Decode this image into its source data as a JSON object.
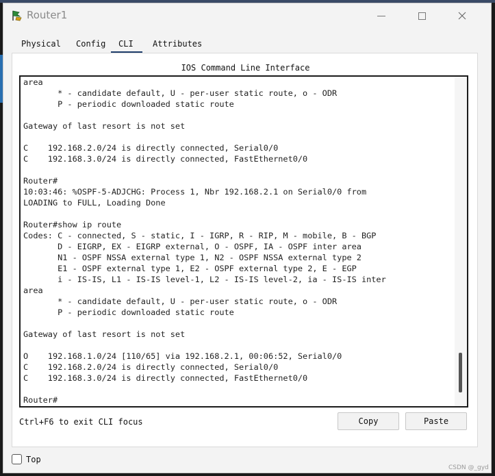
{
  "window": {
    "title": "Router1",
    "controls": {
      "minimize": "minimize",
      "maximize": "maximize",
      "close": "close"
    }
  },
  "tabs": [
    {
      "label": "Physical"
    },
    {
      "label": "Config"
    },
    {
      "label": "CLI",
      "active": true
    },
    {
      "label": "Attributes"
    }
  ],
  "cli": {
    "title": "IOS Command Line Interface",
    "lines": [
      "area",
      "       * - candidate default, U - per-user static route, o - ODR",
      "       P - periodic downloaded static route",
      "",
      "Gateway of last resort is not set",
      "",
      "C    192.168.2.0/24 is directly connected, Serial0/0",
      "C    192.168.3.0/24 is directly connected, FastEthernet0/0",
      "",
      "Router#",
      "10:03:46: %OSPF-5-ADJCHG: Process 1, Nbr 192.168.2.1 on Serial0/0 from",
      "LOADING to FULL, Loading Done",
      "",
      "Router#show ip route",
      "Codes: C - connected, S - static, I - IGRP, R - RIP, M - mobile, B - BGP",
      "       D - EIGRP, EX - EIGRP external, O - OSPF, IA - OSPF inter area",
      "       N1 - OSPF NSSA external type 1, N2 - OSPF NSSA external type 2",
      "       E1 - OSPF external type 1, E2 - OSPF external type 2, E - EGP",
      "       i - IS-IS, L1 - IS-IS level-1, L2 - IS-IS level-2, ia - IS-IS inter",
      "area",
      "       * - candidate default, U - per-user static route, o - ODR",
      "       P - periodic downloaded static route",
      "",
      "Gateway of last resort is not set",
      "",
      "O    192.168.1.0/24 [110/65] via 192.168.2.1, 00:06:52, Serial0/0",
      "C    192.168.2.0/24 is directly connected, Serial0/0",
      "C    192.168.3.0/24 is directly connected, FastEthernet0/0",
      "",
      "Router#"
    ],
    "hint": "Ctrl+F6 to exit CLI focus",
    "copy_label": "Copy",
    "paste_label": "Paste"
  },
  "footer": {
    "top_label": "Top",
    "top_checked": false
  },
  "watermark": "CSDN @_gyd"
}
